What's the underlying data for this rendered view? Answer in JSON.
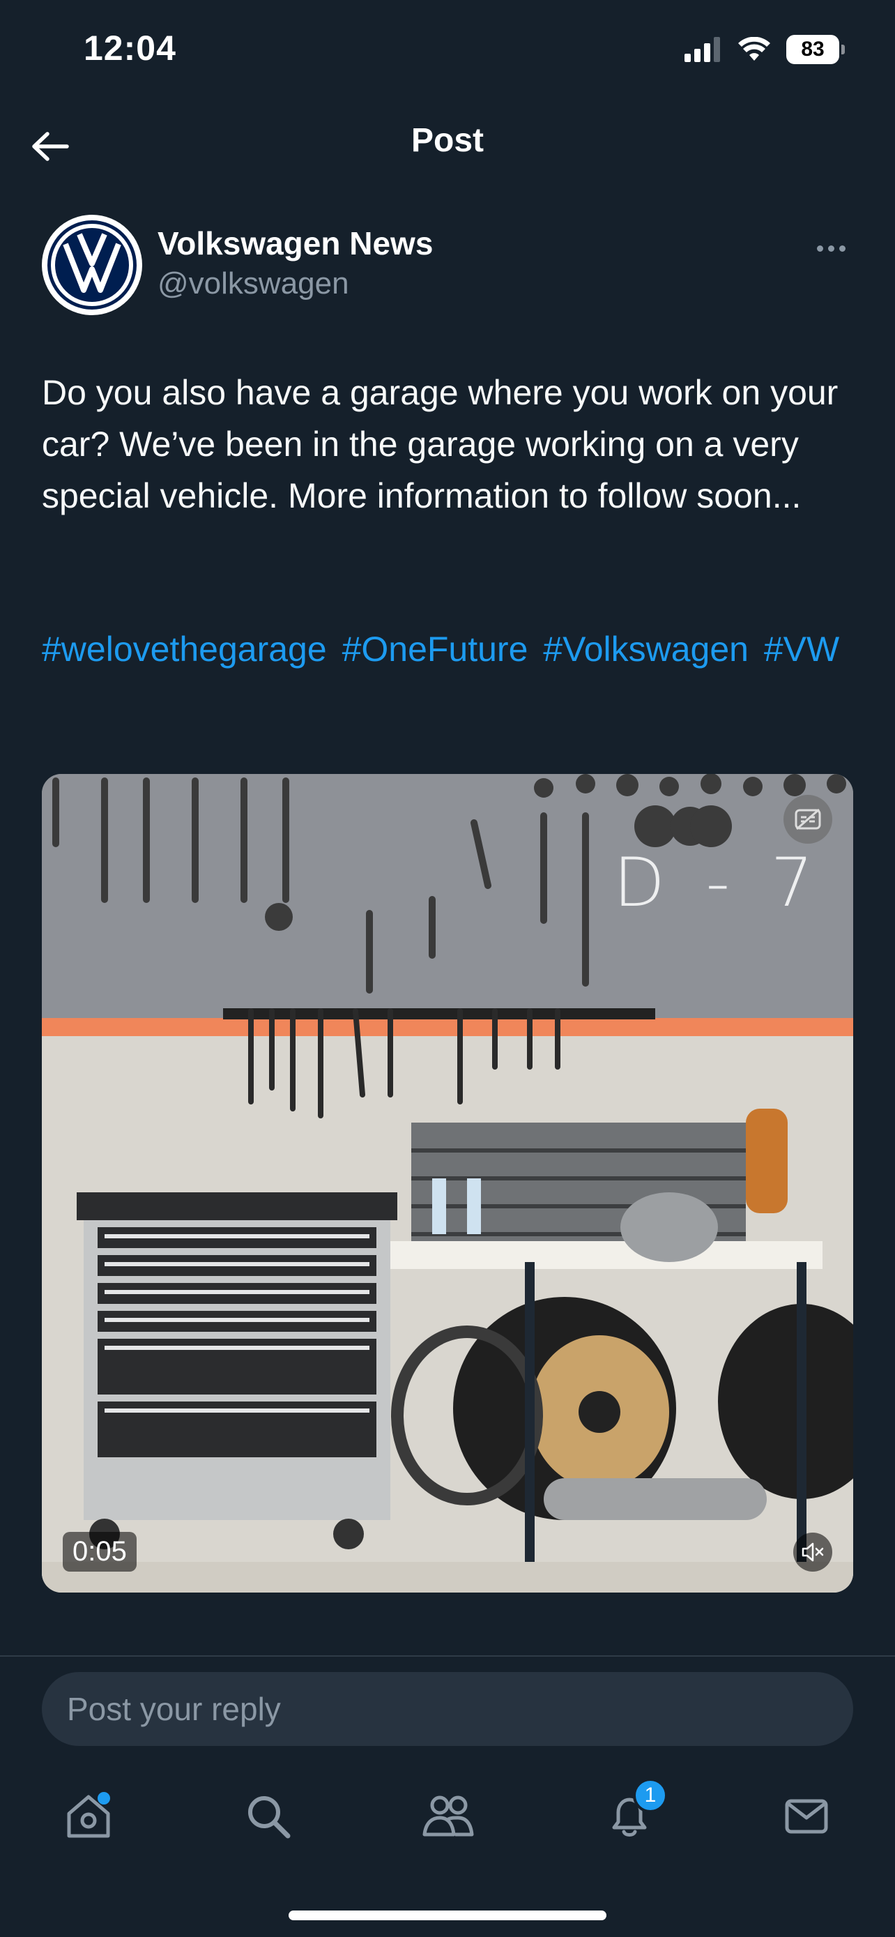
{
  "status_bar": {
    "time": "12:04",
    "battery": "83"
  },
  "header": {
    "title": "Post"
  },
  "author": {
    "name": "Volkswagen News",
    "handle": "@volkswagen"
  },
  "post": {
    "text": "Do you also have a garage where you work on your car? We’ve been in the garage working on a very special vehicle. More information to follow soon...",
    "hashtags": [
      "#welovethegarage",
      "#OneFuture",
      "#Volkswagen",
      "#VW"
    ]
  },
  "media": {
    "video_time": "0:05",
    "watermark": "D - 7"
  },
  "reply": {
    "placeholder": "Post your reply"
  },
  "tabbar": {
    "notification_count": "1"
  },
  "colors": {
    "background": "#15202b",
    "accent": "#1d9bf0",
    "muted": "#8b98a5"
  },
  "icons": [
    "back-arrow-icon",
    "more-icon",
    "captions-off-icon",
    "mute-icon",
    "home-icon",
    "search-icon",
    "communities-icon",
    "bell-icon",
    "mail-icon",
    "signal-icon",
    "wifi-icon"
  ]
}
